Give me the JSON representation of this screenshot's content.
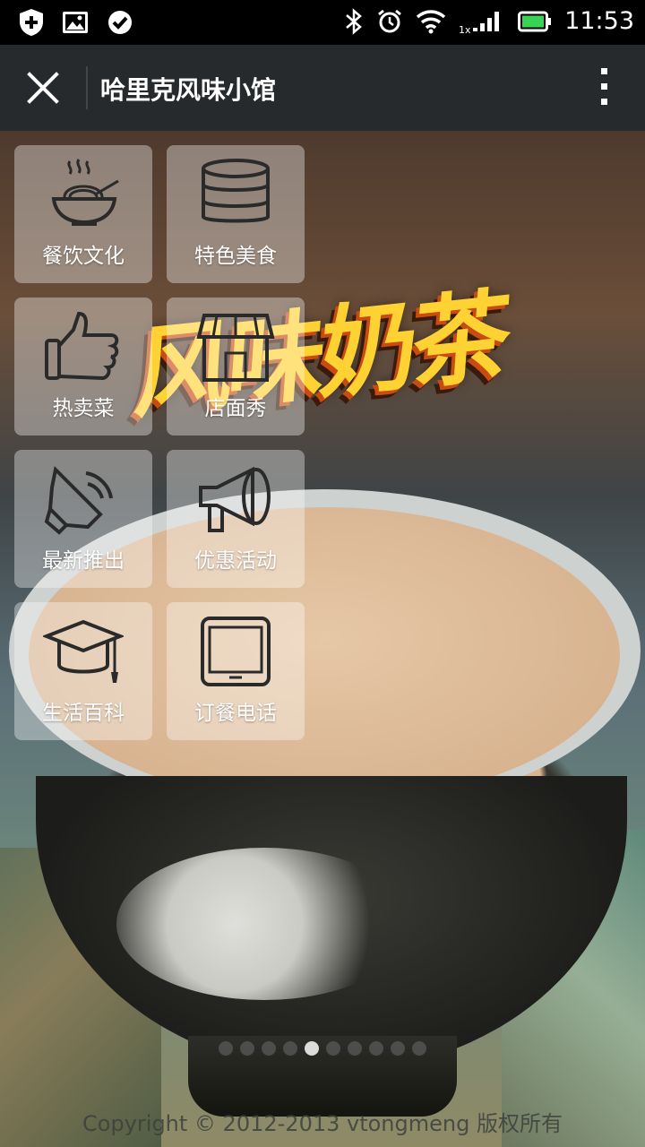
{
  "status_bar": {
    "time": "11:53",
    "left_icons": [
      "shield-plus-icon",
      "image-icon",
      "check-circle-icon"
    ],
    "right_icons": [
      "bluetooth-icon",
      "alarm-icon",
      "wifi-icon",
      "signal-icon",
      "battery-icon"
    ],
    "network_label": "1x"
  },
  "app_bar": {
    "title": "哈里克风味小馆",
    "close_icon": "close-icon",
    "more_icon": "more-vertical-icon"
  },
  "banner": {
    "headline": "风味奶茶"
  },
  "menu_tiles": [
    {
      "label": "餐饮文化",
      "icon": "noodle-bowl-icon"
    },
    {
      "label": "特色美食",
      "icon": "database-stack-icon"
    },
    {
      "label": "热卖菜",
      "icon": "thumbs-up-icon"
    },
    {
      "label": "店面秀",
      "icon": "storefront-icon"
    },
    {
      "label": "最新推出",
      "icon": "speaker-icon"
    },
    {
      "label": "优惠活动",
      "icon": "megaphone-icon"
    },
    {
      "label": "生活百科",
      "icon": "graduation-cap-icon"
    },
    {
      "label": "订餐电话",
      "icon": "tablet-icon"
    }
  ],
  "carousel": {
    "total_pages": 10,
    "active_page": 5
  },
  "footer": {
    "copyright": "Copyright © 2012-2013 vtongmeng 版权所有"
  }
}
